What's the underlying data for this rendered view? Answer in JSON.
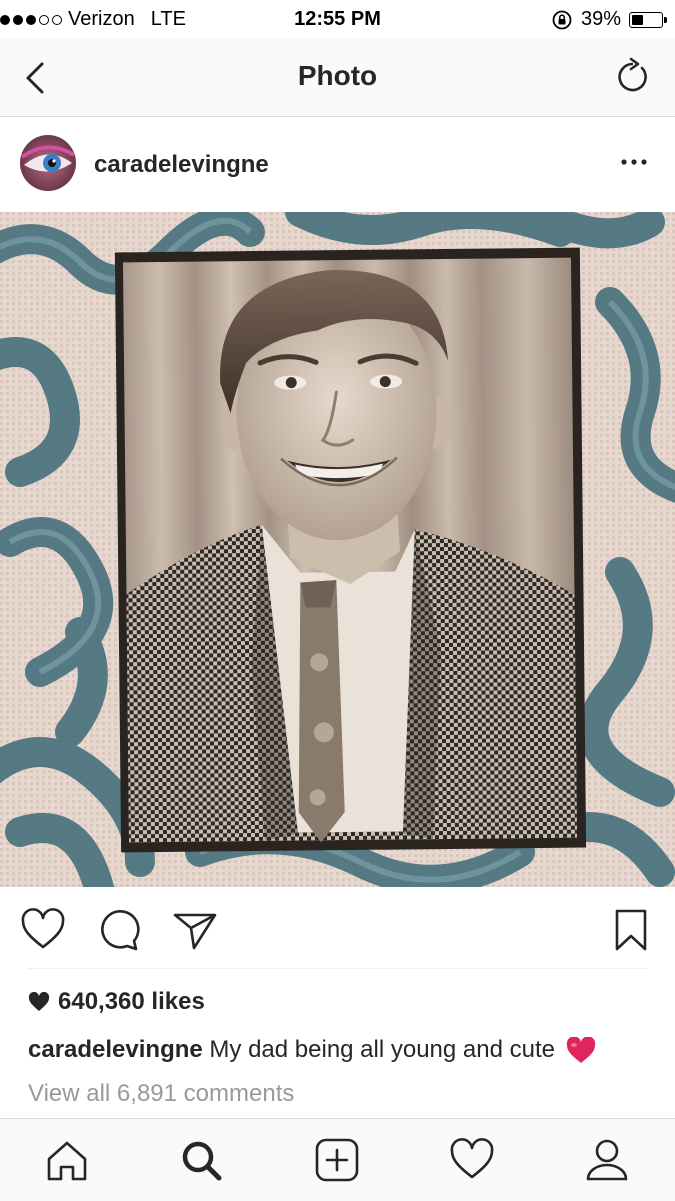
{
  "status_bar": {
    "carrier": "Verizon",
    "network": "LTE",
    "time": "12:55 PM",
    "battery": "39%",
    "battery_level": 0.39,
    "signal_bars": 3,
    "signal_total": 5
  },
  "nav": {
    "title": "Photo",
    "back_icon": "chevron-left-icon",
    "refresh_icon": "refresh-icon"
  },
  "post": {
    "username": "caradelevingne",
    "more_icon": "more-dots-icon",
    "likes": "640,360 likes",
    "caption_user": "caradelevingne",
    "caption_text": "My dad being all young and cute",
    "view_comments": "View all 6,891 comments"
  },
  "actions": {
    "icons": [
      "heart-icon",
      "comment-icon",
      "share-icon",
      "bookmark-icon"
    ]
  },
  "tab_bar": {
    "icons": [
      "home-icon",
      "search-icon",
      "add-icon",
      "activity-icon",
      "profile-icon"
    ],
    "active": "search-icon"
  },
  "colors": {
    "text": "#262626",
    "muted": "#999999",
    "divider": "#dbdbdb",
    "emoji_heart": "#e0245e"
  }
}
